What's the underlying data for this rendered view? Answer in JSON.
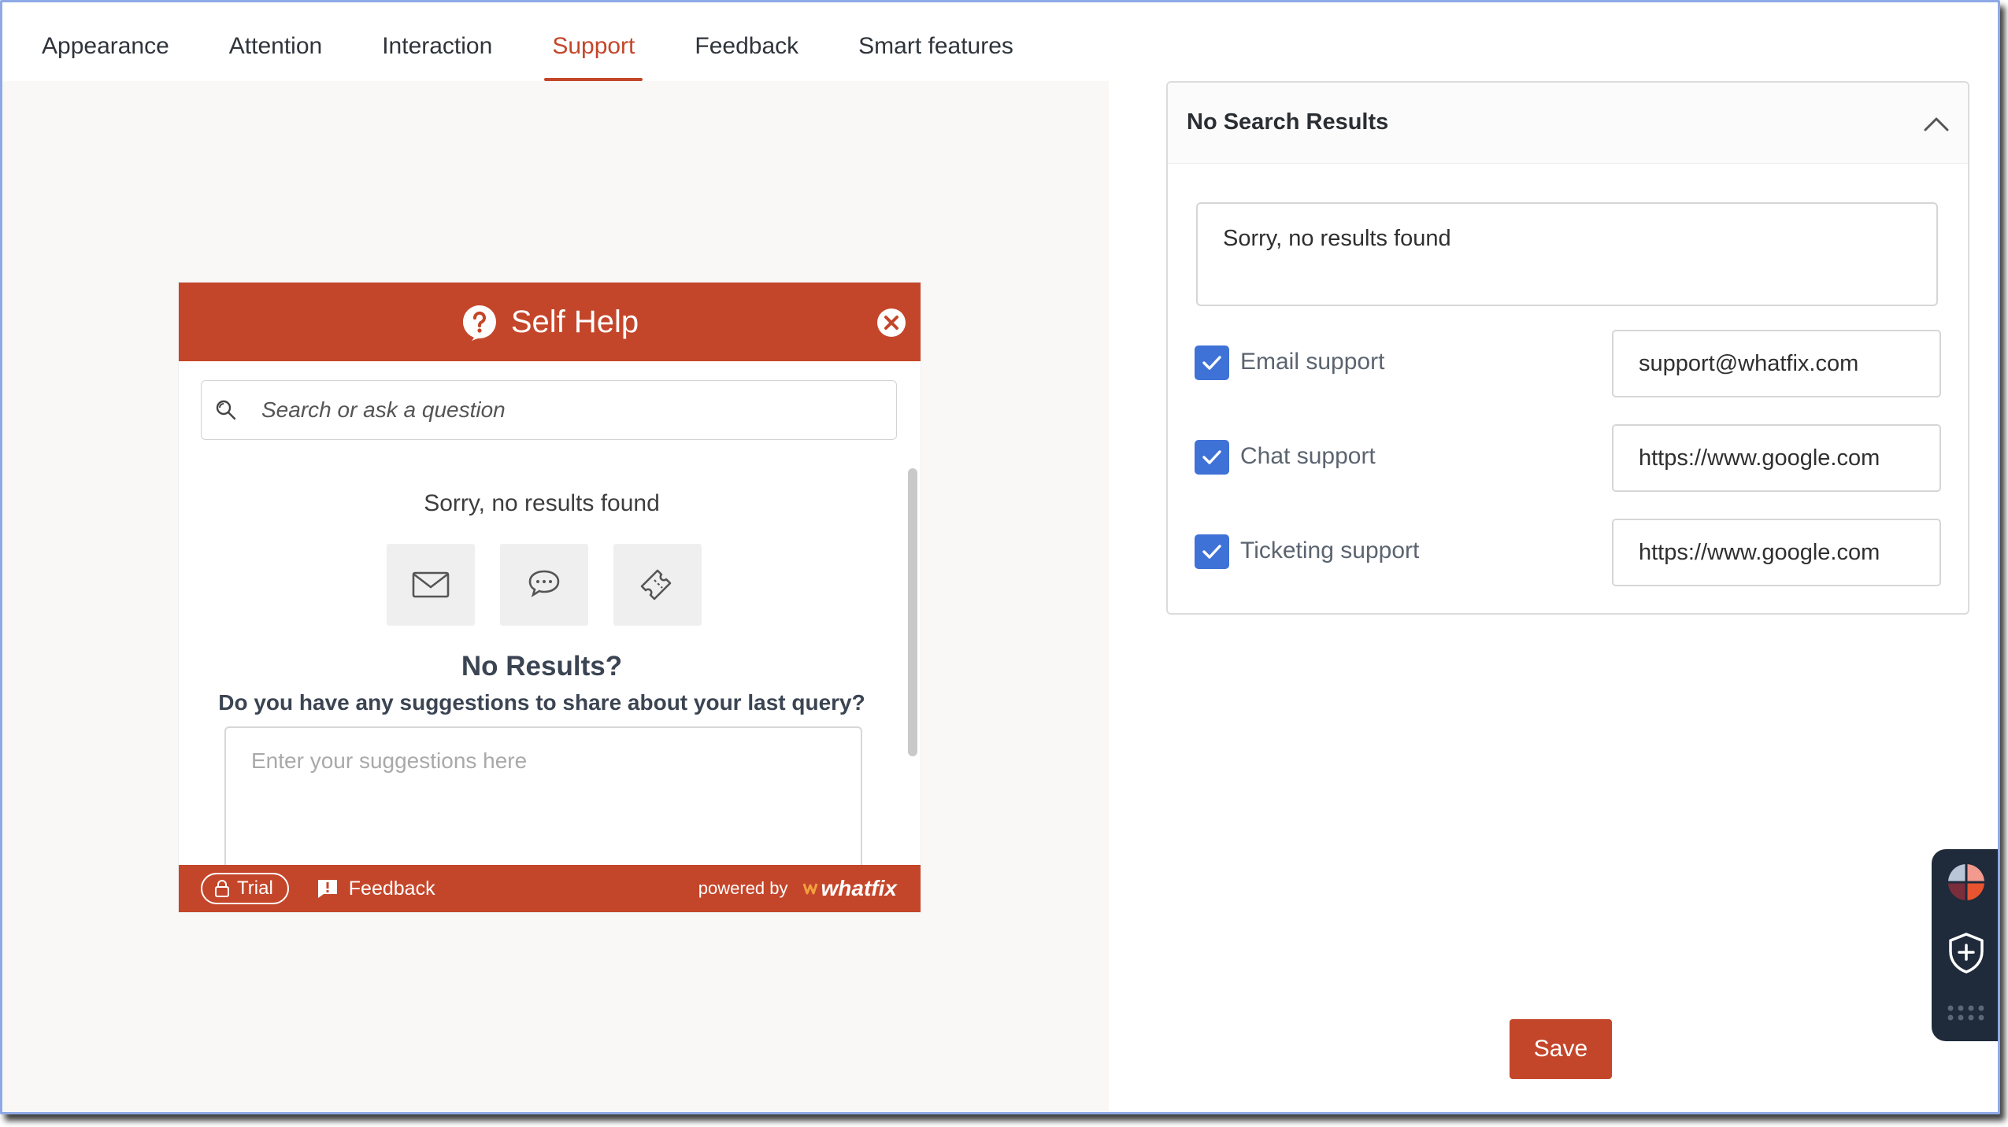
{
  "tabs": [
    {
      "label": "Appearance"
    },
    {
      "label": "Attention"
    },
    {
      "label": "Interaction"
    },
    {
      "label": "Support",
      "active": true
    },
    {
      "label": "Feedback"
    },
    {
      "label": "Smart features"
    }
  ],
  "widget": {
    "title": "Self Help",
    "search_placeholder": "Search or ask a question",
    "no_results_text": "Sorry, no results found",
    "support_icons": [
      "mail-icon",
      "chat-icon",
      "ticket-icon"
    ],
    "no_results_heading": "No Results?",
    "suggestion_question": "Do you have any suggestions to share about your last query?",
    "suggestion_placeholder": "Enter your suggestions here",
    "footer": {
      "trial_label": "Trial",
      "feedback_label": "Feedback",
      "powered_by": "powered by",
      "brand": "whatfix"
    }
  },
  "panel": {
    "title": "No Search Results",
    "message": "Sorry, no results found",
    "options": [
      {
        "label": "Email support",
        "checked": true,
        "value": "support@whatfix.com"
      },
      {
        "label": "Chat support",
        "checked": true,
        "value": "https://www.google.com"
      },
      {
        "label": "Ticketing support",
        "checked": true,
        "value": "https://www.google.com"
      }
    ]
  },
  "save_label": "Save",
  "colors": {
    "brand": "#c4462a",
    "checkbox": "#3f72d7",
    "dock": "#1f2a3a"
  }
}
